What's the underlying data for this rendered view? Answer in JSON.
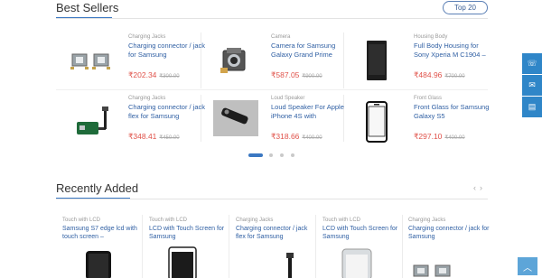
{
  "best_sellers": {
    "title": "Best Sellers",
    "top_button": "Top 20",
    "products": [
      {
        "category": "Charging Jacks",
        "name": "Charging connector / jack for Samsung",
        "price": "₹202.34",
        "old_price": "₹300.00"
      },
      {
        "category": "Camera",
        "name": "Camera for Samsung Galaxy Grand Prime",
        "price": "₹587.05",
        "old_price": "₹900.00"
      },
      {
        "category": "Housing Body",
        "name": "Full Body Housing for Sony Xperia M C1904 –",
        "price": "₹484.96",
        "old_price": "₹700.00"
      },
      {
        "category": "Charging Jacks",
        "name": "Charging connector / jack flex for Samsung",
        "price": "₹348.41",
        "old_price": "₹450.00"
      },
      {
        "category": "Loud Speaker",
        "name": "Loud Speaker For Apple iPhone 4S with",
        "price": "₹318.66",
        "old_price": "₹400.00"
      },
      {
        "category": "Front Glass",
        "name": "Front Glass for Samsung Galaxy S5",
        "price": "₹297.10",
        "old_price": "₹400.00"
      }
    ],
    "carousel": {
      "pages": 4,
      "active": 1
    }
  },
  "recently_added": {
    "title": "Recently Added",
    "prev_icon": "chevron-left-icon",
    "next_icon": "chevron-right-icon",
    "products": [
      {
        "category": "Touch with LCD",
        "name": "Samsung S7 edge lcd with touch screen –"
      },
      {
        "category": "Touch with LCD",
        "name": "LCD with Touch Screen for Samsung"
      },
      {
        "category": "Charging Jacks",
        "name": "Charging connector / jack flex for Samsung"
      },
      {
        "category": "Touch with LCD",
        "name": "LCD with Touch Screen for Samsung"
      },
      {
        "category": "Charging Jacks",
        "name": "Charging connector / jack for Samsung"
      }
    ]
  },
  "side_buttons": [
    {
      "icon": "phone-icon"
    },
    {
      "icon": "mail-icon"
    },
    {
      "icon": "clipboard-icon"
    }
  ],
  "back_to_top_icon": "arrow-up-icon",
  "colors": {
    "accent": "#3b78c2",
    "price": "#e0524a",
    "link": "#2f5fa3",
    "side": "#2f86c8"
  }
}
